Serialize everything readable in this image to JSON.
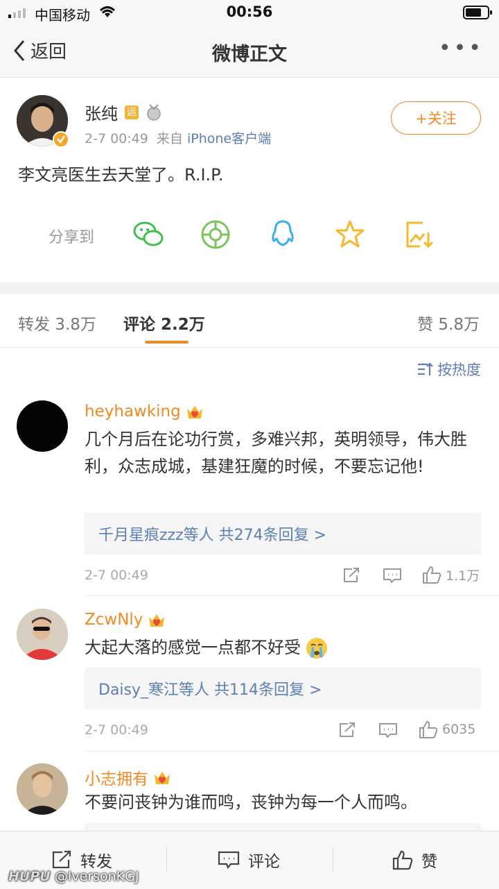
{
  "status_bar": {
    "carrier": "中国移动",
    "time": "00:56"
  },
  "nav": {
    "back_label": "返回",
    "title": "微博正文"
  },
  "post": {
    "author": "张纯",
    "time": "2-7 00:49",
    "source_prefix": "来自",
    "source": "iPhone客户端",
    "follow_label": "+关注",
    "text": "李文亮医生去天堂了。R.I.P.",
    "share_label": "分享到",
    "share_icons": [
      "wechat-icon",
      "moments-icon",
      "qq-icon",
      "star-favorite-icon",
      "save-image-icon"
    ]
  },
  "tabs": {
    "repost": "转发 3.8万",
    "comment": "评论 2.2万",
    "like": "赞 5.8万"
  },
  "sort_label": "按热度",
  "comments": [
    {
      "name": "heyhawking",
      "text": "几个月后在论功行赏，多难兴邦，英明领导，伟大胜利，众志成城，基建狂魔的时候，不要忘记他!",
      "replies": "千月星痕zzz等人  共274条回复 >",
      "time": "2-7 00:49",
      "likes": "1.1万"
    },
    {
      "name": "ZcwNly",
      "text": "大起大落的感觉一点都不好受",
      "replies": "Daisy_寒江等人  共114条回复 >",
      "time": "2-7 00:49",
      "likes": "6035"
    },
    {
      "name": "小志拥有",
      "text": "不要问丧钟为谁而鸣，丧钟为每一个人而鸣。"
    }
  ],
  "bottom_bar": {
    "repost": "转发",
    "comment": "评论",
    "like": "赞"
  },
  "watermark": {
    "site": "HUPU",
    "user": "@IversonKGJ"
  },
  "colors": {
    "accent": "#f08a24",
    "link": "#5d7fb4",
    "text": "#333333",
    "muted": "#999999"
  }
}
